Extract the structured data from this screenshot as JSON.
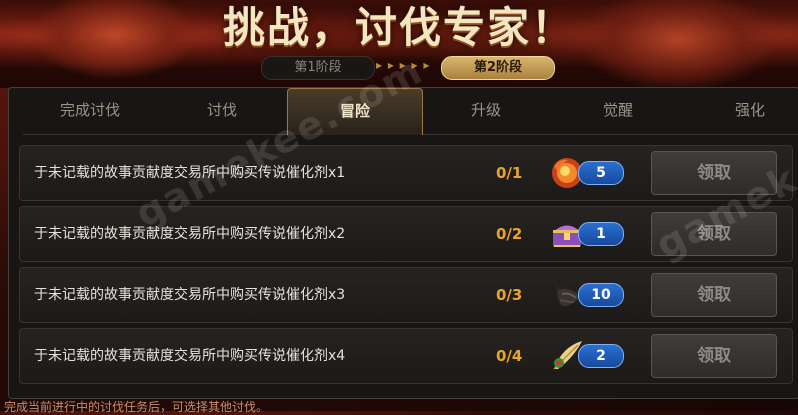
{
  "banner": {
    "title": "挑战，讨伐专家！"
  },
  "stages": {
    "stage1": "第1阶段",
    "stage2": "第2阶段"
  },
  "tabs": [
    {
      "label": "完成讨伐",
      "active": false
    },
    {
      "label": "讨伐",
      "active": false
    },
    {
      "label": "冒险",
      "active": true
    },
    {
      "label": "升级",
      "active": false
    },
    {
      "label": "觉醒",
      "active": false
    },
    {
      "label": "强化",
      "active": false
    }
  ],
  "tasks": [
    {
      "label": "于未记载的故事贡献度交易所中购买传说催化剂x1",
      "progress": "0/1",
      "reward_icon": "fire-orb-icon",
      "reward_count": "5",
      "claim": "领取"
    },
    {
      "label": "于未记载的故事贡献度交易所中购买传说催化剂x2",
      "progress": "0/2",
      "reward_icon": "treasure-chest-icon",
      "reward_count": "1",
      "claim": "领取"
    },
    {
      "label": "于未记载的故事贡献度交易所中购买传说催化剂x3",
      "progress": "0/3",
      "reward_icon": "dark-material-icon",
      "reward_count": "10",
      "claim": "领取"
    },
    {
      "label": "于未记载的故事贡献度交易所中购买传说催化剂x4",
      "progress": "0/4",
      "reward_icon": "feather-icon",
      "reward_count": "2",
      "claim": "领取"
    }
  ],
  "footer": {
    "text": "完成当前进行中的讨伐任务后，可选择其他讨伐。"
  },
  "watermark": {
    "text": "gamekee.com",
    "text2": "gamek"
  },
  "colors": {
    "progress": "#e9a42a",
    "badge": "#2b6fd2",
    "active_tab_border": "#9c7a46"
  }
}
